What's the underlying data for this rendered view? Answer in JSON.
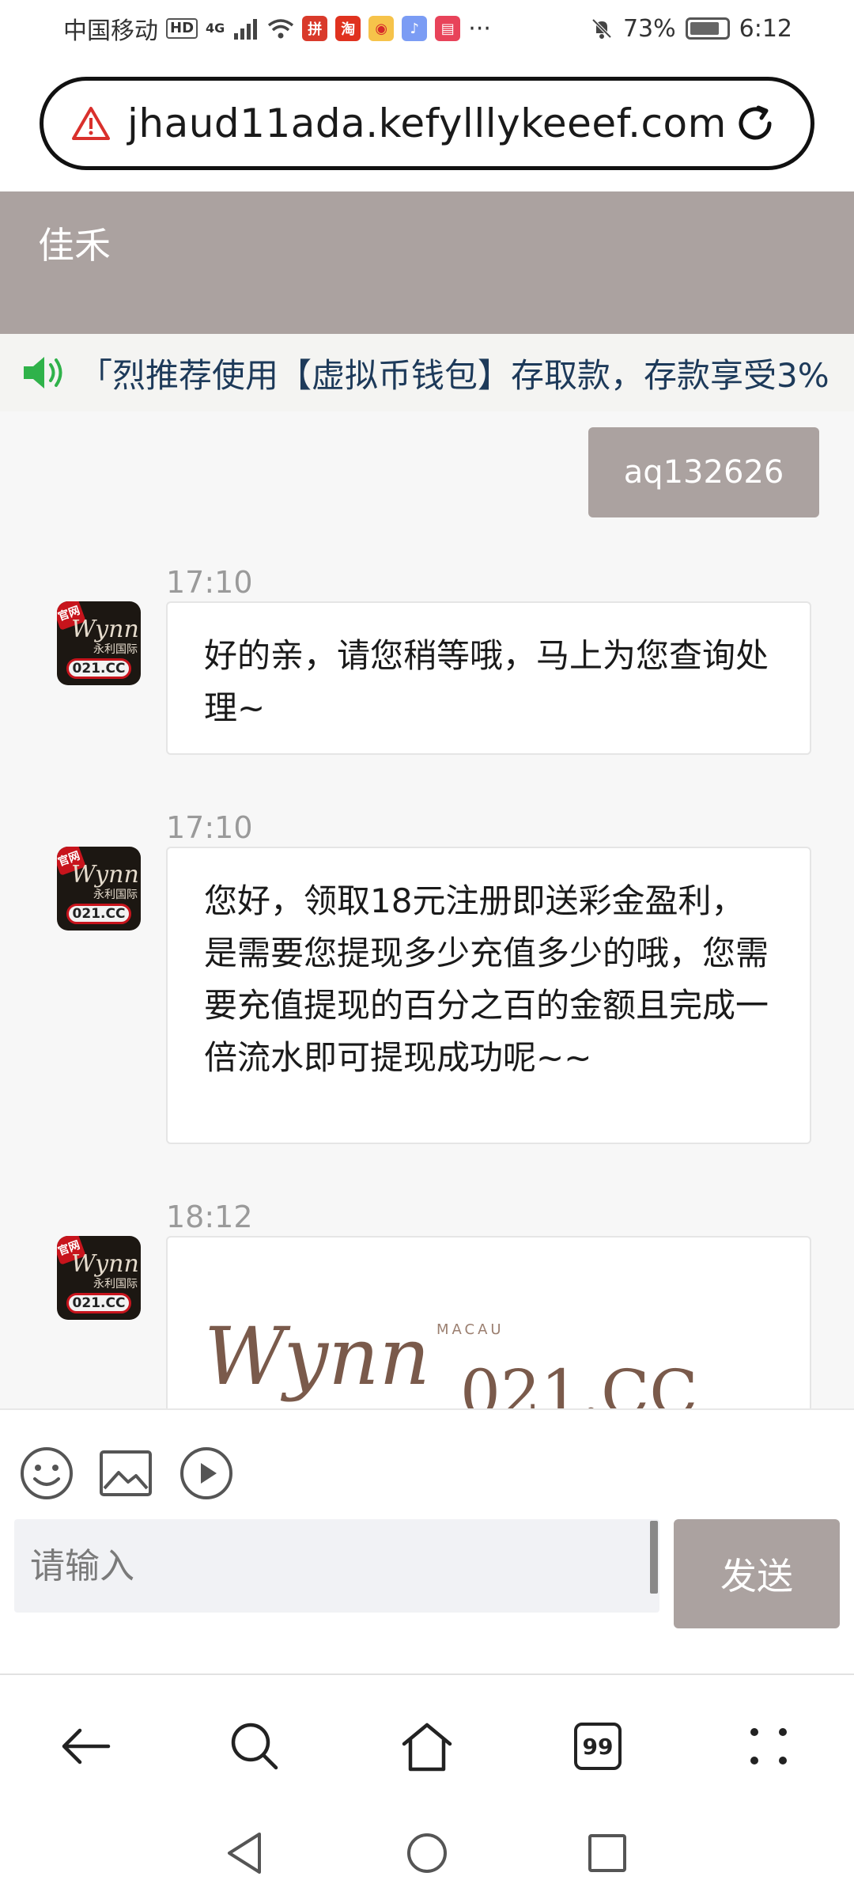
{
  "status_bar": {
    "carrier": "中国移动",
    "hd": "HD",
    "network": "4G",
    "battery": "73%",
    "time": "6:12"
  },
  "browser": {
    "url": "jhaud11ada.kefylllykeeef.com",
    "tab_count": "99"
  },
  "chat": {
    "title": "佳禾",
    "notice": "「烈推荐使用【虚拟币钱包】存取款，存款享受3%",
    "user_message": "aq132626",
    "messages": [
      {
        "time": "17:10",
        "text": "好的亲，请您稍等哦，马上为您查询处理~"
      },
      {
        "time": "17:10",
        "text": "您好，领取18元注册即送彩金盈利，是需要您提现多少充值多少的哦，您需要充值提现的百分之百的金额且完成一倍流水即可提现成功呢~~"
      },
      {
        "time": "18:12",
        "image_logo": "Wynn",
        "image_sub": "MACAU",
        "image_code": "021.CC"
      }
    ],
    "avatar": {
      "tag": "官网",
      "brand": "Wynn",
      "brand_cn": "永利国际",
      "code": "021.CC"
    }
  },
  "input": {
    "placeholder": "请输入",
    "send_label": "发送"
  },
  "colors": {
    "header": "#aba2a0",
    "notice_text": "#1d3a5a",
    "speaker": "#2fb24a"
  }
}
